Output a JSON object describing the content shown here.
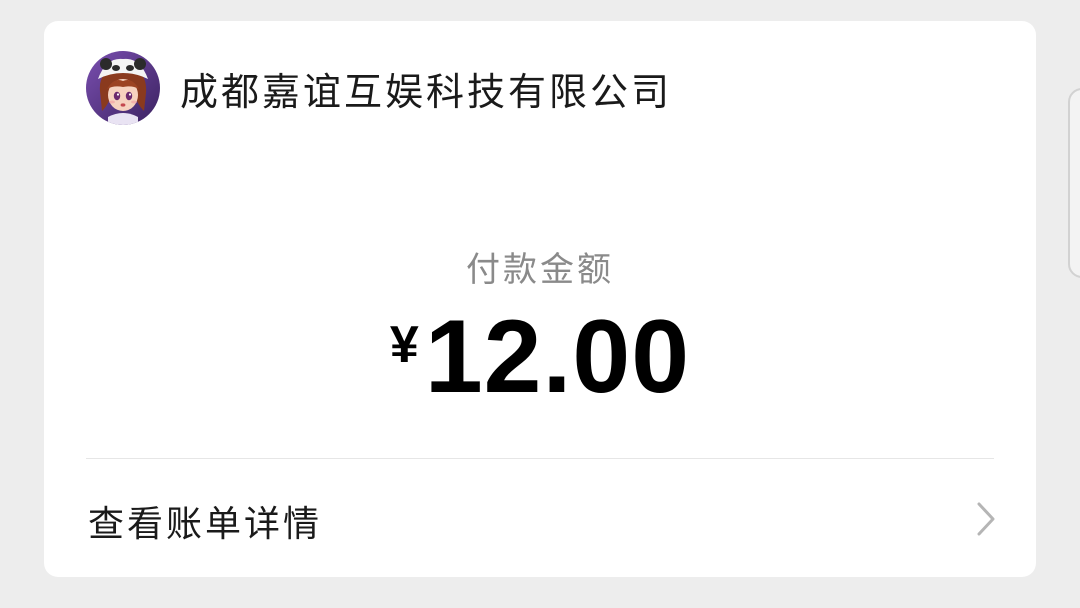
{
  "merchant": {
    "name": "成都嘉谊互娱科技有限公司",
    "avatar_icon": "anime-avatar"
  },
  "payment": {
    "label": "付款金额",
    "currency_symbol": "¥",
    "amount": "12.00"
  },
  "bill_details": {
    "label": "查看账单详情",
    "icon": "chevron-right-icon"
  }
}
